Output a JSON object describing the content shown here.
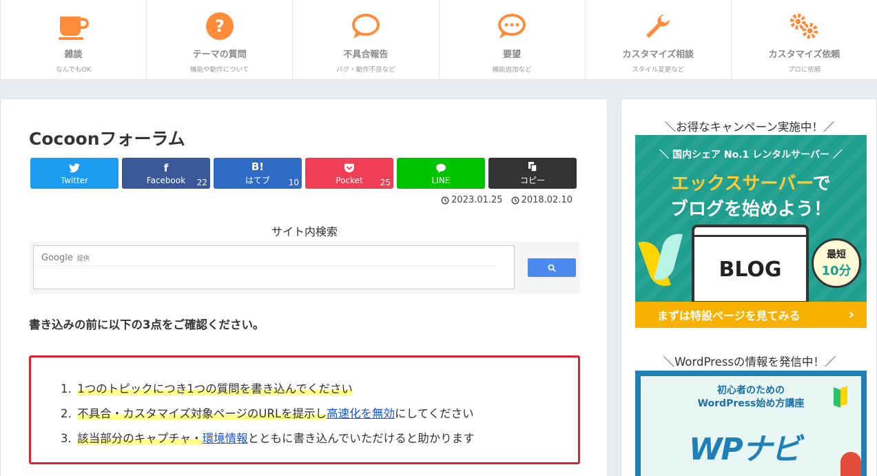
{
  "topnav": [
    {
      "title": "雑談",
      "sub": "なんでもOK",
      "icon": "coffee-cup-icon"
    },
    {
      "title": "テーマの質問",
      "sub": "機能や動作について",
      "icon": "question-circle-icon"
    },
    {
      "title": "不具合報告",
      "sub": "バグ・動作不良など",
      "icon": "speech-bubble-icon"
    },
    {
      "title": "要望",
      "sub": "機能追加など",
      "icon": "chat-dots-icon"
    },
    {
      "title": "カスタマイズ相談",
      "sub": "スタイル変更など",
      "icon": "wrench-icon"
    },
    {
      "title": "カスタマイズ依頼",
      "sub": "プロに依頼",
      "icon": "gears-icon"
    }
  ],
  "accent": "#ff8c3a",
  "page": {
    "title": "Cocoonフォーラム"
  },
  "share": [
    {
      "label": "Twitter",
      "count": "",
      "icon": "twitter-icon",
      "color": "#1d9bf0"
    },
    {
      "label": "Facebook",
      "count": "22",
      "icon": "facebook-icon",
      "color": "#3b5998"
    },
    {
      "label": "はてブ",
      "count": "10",
      "icon": "hatena-icon",
      "color": "#2d6bc7"
    },
    {
      "label": "Pocket",
      "count": "25",
      "icon": "pocket-icon",
      "color": "#ef3f56"
    },
    {
      "label": "LINE",
      "count": "",
      "icon": "line-icon",
      "color": "#00c300"
    },
    {
      "label": "コピー",
      "count": "",
      "icon": "copy-icon",
      "color": "#333333"
    }
  ],
  "dates": {
    "updated": "2023.01.25",
    "published": "2018.02.10"
  },
  "search": {
    "title": "サイト内検索",
    "google": "Google",
    "provided": "提供"
  },
  "notice": "書き込みの前に以下の3点をご確認ください。",
  "rules": {
    "r1": {
      "num": "1.",
      "text": "1つのトピックにつき1つの質問を書き込んでください"
    },
    "r2": {
      "num": "2.",
      "pre": "不具合・カスタマイズ対象ページのURLを提示し",
      "link": "高速化を無効",
      "post": "にしてください"
    },
    "r3": {
      "num": "3.",
      "pre": "該当部分のキャプチャ・",
      "link": "環境情報",
      "post": "とともに書き込んでいただけると助かります"
    }
  },
  "sidebar": {
    "widget1_title": "＼お得なキャンペーン実施中！／",
    "ad1": {
      "top": "＼ 国内シェア No.1 レンタルサーバー ／",
      "brand": "エックスサーバー",
      "brand_suffix": "で",
      "line2": "ブログを始めよう！",
      "screen": "BLOG",
      "badge1": "最短",
      "badge2": "10分",
      "cta": "まずは特設ページを見てみる",
      "cta_arrow": "›"
    },
    "widget2_title": "＼WordPressの情報を発信中！／",
    "ad2": {
      "line1": "初心者のための",
      "line2": "WordPress始め方講座",
      "logo": "WPナビ"
    }
  }
}
